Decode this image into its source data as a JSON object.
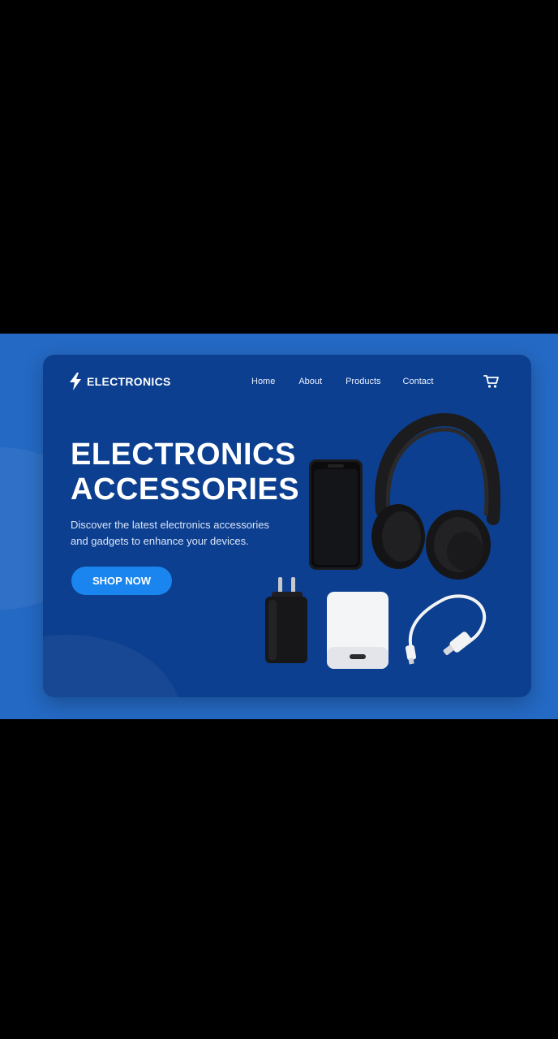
{
  "brand": {
    "name": "ELECTRONICS",
    "icon": "lightning-bolt-icon"
  },
  "nav": {
    "items": [
      "Home",
      "About",
      "Products",
      "Contact"
    ],
    "cart_icon": "shopping-cart-icon"
  },
  "hero": {
    "title_line1": "ELECTRONICS",
    "title_line2": "ACCESSORIES",
    "description": "Discover the latest electronics accessories and gadgets to enhance your devices.",
    "cta_label": "SHOP NOW"
  },
  "products": [
    "smartphone",
    "headphones",
    "wall-charger",
    "power-bank",
    "usb-c-cable"
  ],
  "colors": {
    "background": "#2469c4",
    "card": "#0c3f8f",
    "button": "#1a85ef",
    "text": "#ffffff"
  }
}
